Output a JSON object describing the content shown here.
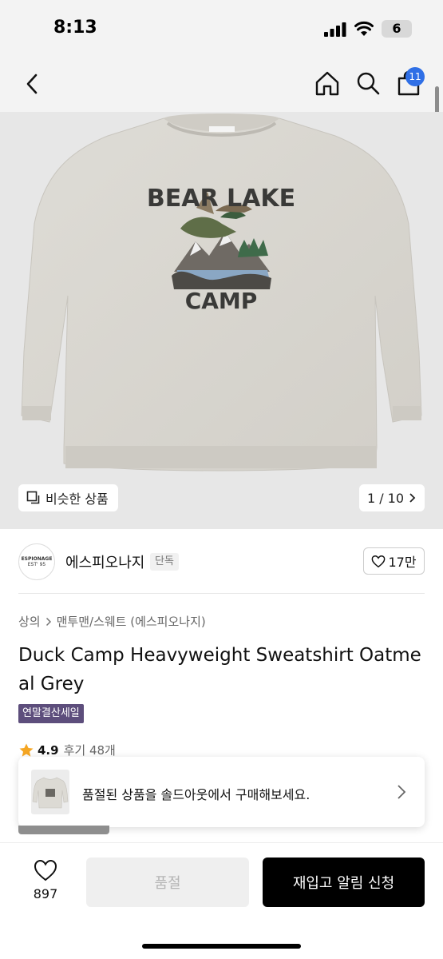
{
  "status_bar": {
    "time": "8:13",
    "battery": "6"
  },
  "header": {
    "cart_count": "11"
  },
  "gallery": {
    "similar_label": "비슷한 상품",
    "page_counter": "1 / 10",
    "artwork": {
      "top_text": "BEAR LAKE",
      "bottom_text": "CAMP"
    }
  },
  "brand": {
    "name": "에스피오나지",
    "badge": "단독",
    "logo_text": "ESPIONAGE",
    "logo_subtext": "EST' 95",
    "likes": "17만"
  },
  "product": {
    "breadcrumb": [
      "상의",
      "맨투맨/스웨트 (에스피오나지)"
    ],
    "title": "Duck Camp Heavyweight Sweatshirt Oatmeal Grey",
    "sale_badge": "연말결산세일",
    "rating": "4.9",
    "reviews": "후기 48개"
  },
  "soldout_popup": {
    "text": "품절된 상품을 솔드아웃에서 구매해보세요."
  },
  "bottom_bar": {
    "wish_count": "897",
    "soldout_label": "품절",
    "restock_label": "재입고 알림 신청"
  },
  "colors": {
    "accent": "#2f6fe6",
    "sale_badge": "#5d4e7c",
    "star": "#f5a623"
  }
}
